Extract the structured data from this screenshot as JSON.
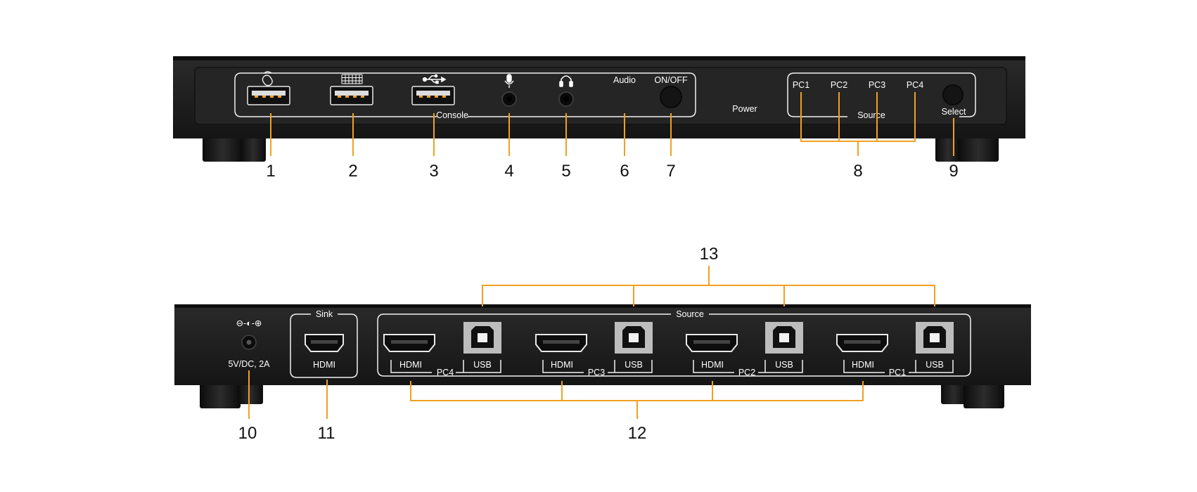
{
  "front": {
    "console_label": "Console",
    "audio_label": "Audio",
    "onoff_label": "ON/OFF",
    "power_label": "Power",
    "pc_labels": [
      "PC1",
      "PC2",
      "PC3",
      "PC4"
    ],
    "source_label": "Source",
    "select_label": "Select"
  },
  "rear": {
    "polarity_symbol": "⊖-◐-⊕",
    "power_rating": "5V/DC, 2A",
    "sink_label": "Sink",
    "sink_hdmi_label": "HDMI",
    "source_label": "Source",
    "groups": [
      {
        "hdmi": "HDMI",
        "pc": "PC4",
        "usb": "USB"
      },
      {
        "hdmi": "HDMI",
        "pc": "PC3",
        "usb": "USB"
      },
      {
        "hdmi": "HDMI",
        "pc": "PC2",
        "usb": "USB"
      },
      {
        "hdmi": "HDMI",
        "pc": "PC1",
        "usb": "USB"
      }
    ]
  },
  "callouts": [
    "1",
    "2",
    "3",
    "4",
    "5",
    "6",
    "7",
    "8",
    "9",
    "10",
    "11",
    "12",
    "13"
  ],
  "colors": {
    "body": "#1c1c1c",
    "panel": "#262626",
    "accent": "#f0a023",
    "label": "#ffffff"
  }
}
